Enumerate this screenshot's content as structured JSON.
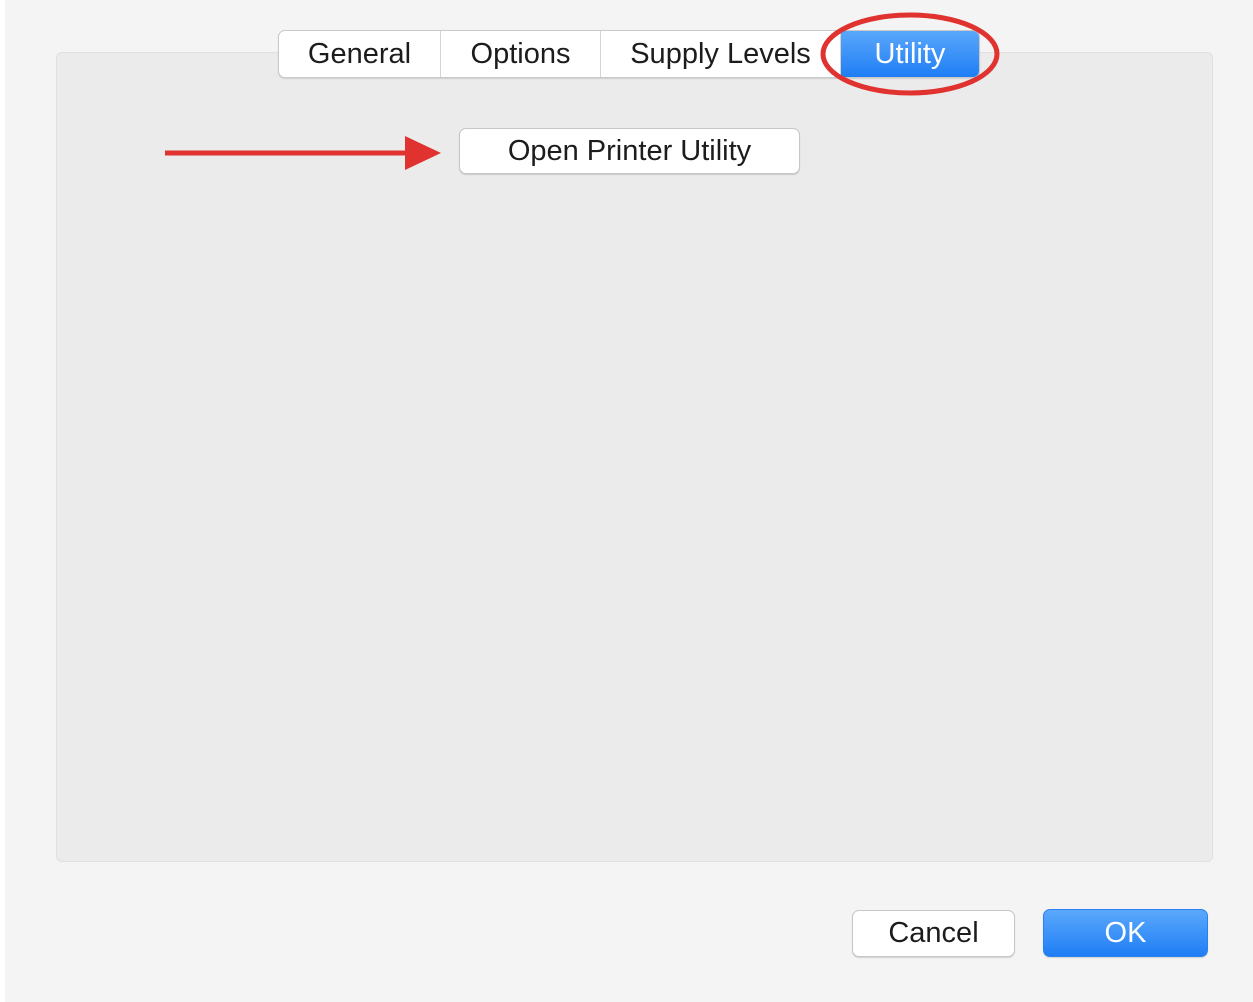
{
  "tabs": [
    {
      "label": "General",
      "selected": false
    },
    {
      "label": "Options",
      "selected": false
    },
    {
      "label": "Supply Levels",
      "selected": false
    },
    {
      "label": "Utility",
      "selected": true
    }
  ],
  "panel": {
    "open_utility_label": "Open Printer Utility"
  },
  "footer": {
    "cancel_label": "Cancel",
    "ok_label": "OK"
  },
  "colors": {
    "accent_blue": "#1f7ef5",
    "annotation_red": "#e0322f",
    "window_bg": "#f4f4f4",
    "panel_bg": "#ebebeb"
  },
  "annotations": {
    "highlight": "red ellipse around Utility tab",
    "pointer": "red arrow pointing to Open Printer Utility button"
  }
}
